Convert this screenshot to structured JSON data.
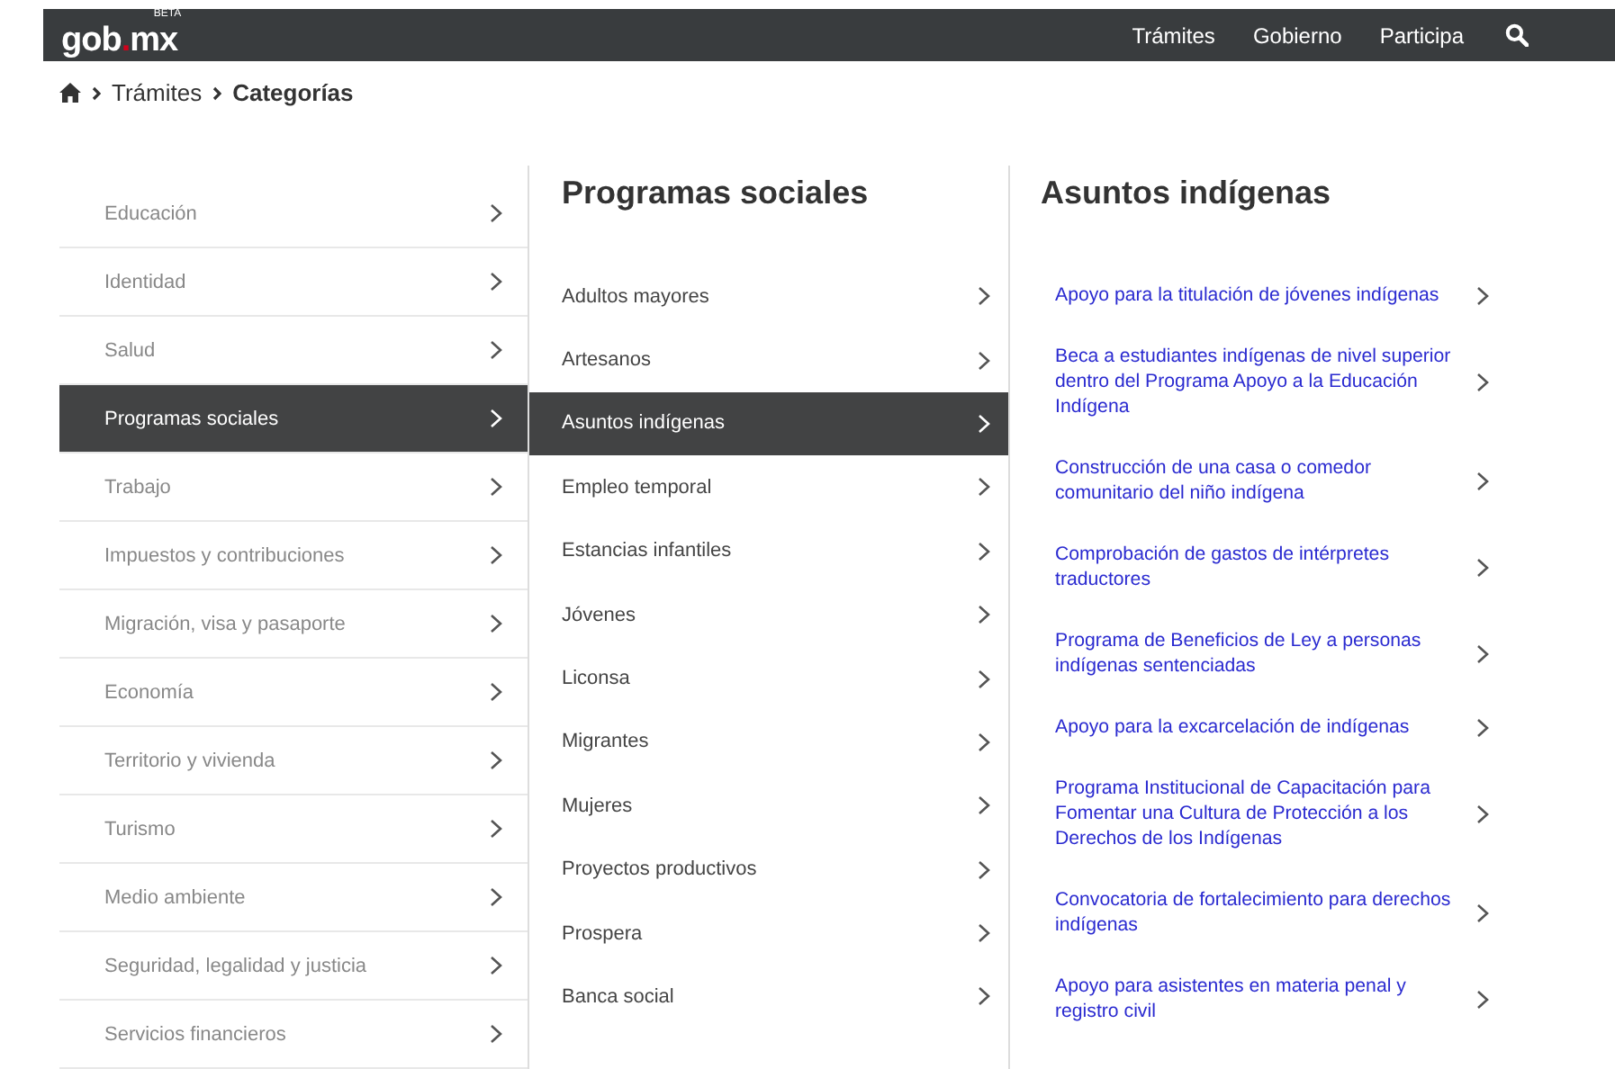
{
  "header": {
    "logo": {
      "text_before": "gob",
      "dot": ".",
      "text_after": "mx",
      "badge": "BETA"
    },
    "nav": [
      {
        "label": "Trámites"
      },
      {
        "label": "Gobierno"
      },
      {
        "label": "Participa"
      }
    ]
  },
  "breadcrumb": [
    {
      "label": "Trámites",
      "current": false
    },
    {
      "label": "Categorías",
      "current": true
    }
  ],
  "categories": [
    {
      "label": "Educación",
      "selected": false
    },
    {
      "label": "Identidad",
      "selected": false
    },
    {
      "label": "Salud",
      "selected": false
    },
    {
      "label": "Programas sociales",
      "selected": true
    },
    {
      "label": "Trabajo",
      "selected": false
    },
    {
      "label": "Impuestos y contribuciones",
      "selected": false
    },
    {
      "label": "Migración, visa y pasaporte",
      "selected": false
    },
    {
      "label": "Economía",
      "selected": false
    },
    {
      "label": "Territorio y vivienda",
      "selected": false
    },
    {
      "label": "Turismo",
      "selected": false
    },
    {
      "label": "Medio ambiente",
      "selected": false
    },
    {
      "label": "Seguridad, legalidad y justicia",
      "selected": false
    },
    {
      "label": "Servicios financieros",
      "selected": false
    }
  ],
  "subcategories": {
    "title": "Programas sociales",
    "items": [
      {
        "label": "Adultos mayores",
        "selected": false
      },
      {
        "label": "Artesanos",
        "selected": false
      },
      {
        "label": "Asuntos indígenas",
        "selected": true
      },
      {
        "label": "Empleo temporal",
        "selected": false
      },
      {
        "label": "Estancias infantiles",
        "selected": false
      },
      {
        "label": "Jóvenes",
        "selected": false
      },
      {
        "label": "Liconsa",
        "selected": false
      },
      {
        "label": "Migrantes",
        "selected": false
      },
      {
        "label": "Mujeres",
        "selected": false
      },
      {
        "label": "Proyectos productivos",
        "selected": false
      },
      {
        "label": "Prospera",
        "selected": false
      },
      {
        "label": "Banca social",
        "selected": false
      }
    ]
  },
  "procedures": {
    "title": "Asuntos indígenas",
    "items": [
      {
        "label": "Apoyo para la titulación de jóvenes indígenas"
      },
      {
        "label": "Beca a estudiantes indígenas de nivel superior dentro del Programa Apoyo a la Educación Indígena"
      },
      {
        "label": "Construcción de una casa o comedor comunitario del niño indígena"
      },
      {
        "label": "Comprobación de gastos de intérpretes traductores"
      },
      {
        "label": "Programa de Beneficios de Ley a personas indígenas sentenciadas"
      },
      {
        "label": "Apoyo para la excarcelación de indígenas"
      },
      {
        "label": "Programa Institucional de Capacitación para Fomentar una Cultura de Protección a los Derechos de los Indígenas"
      },
      {
        "label": "Convocatoria de fortalecimiento para derechos indígenas"
      },
      {
        "label": "Apoyo para asistentes en materia penal y registro civil"
      }
    ]
  }
}
